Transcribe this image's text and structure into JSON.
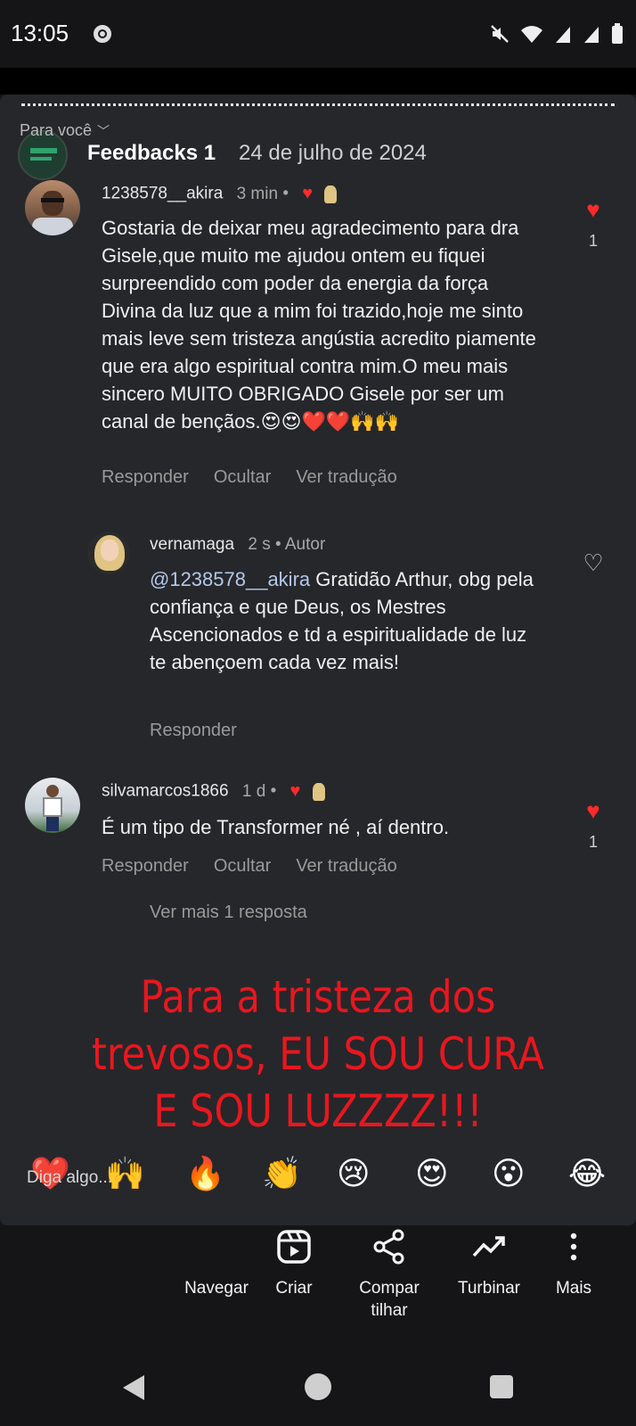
{
  "status_bar": {
    "time": "13:05",
    "icons": [
      "chrome-icon",
      "mute-icon",
      "wifi-icon",
      "signal-icon",
      "signal-icon",
      "battery-icon"
    ]
  },
  "header": {
    "feed_label": "Para você",
    "title": "Feedbacks 1",
    "date": "24 de julho de 2024"
  },
  "comments": [
    {
      "username": "1238578__akira",
      "time": "3 min",
      "body": "Gostaria de deixar meu agradecimento para dra Gisele,que muito me ajudou ontem eu fiquei surpreendido com poder da energia da força Divina da luz que a mim foi trazido,hoje me sinto mais leve sem tristeza angústia acredito piamente que era algo espiritual contra mim.O meu mais sincero MUITO OBRIGADO Gisele por ser um canal de bençãos.😍😍❤️❤️🙌🙌",
      "actions": [
        "Responder",
        "Ocultar",
        "Ver tradução"
      ],
      "likes": "1",
      "liked": true
    },
    {
      "username": "vernamaga",
      "time": "2 s",
      "badge": "Autor",
      "mention": "@1238578__akira",
      "body": " Gratidão Arthur, obg pela confiança e que Deus, os Mestres Ascencionados e td a espiritualidade de luz te abençoem cada vez mais!",
      "actions": [
        "Responder"
      ],
      "liked": false
    },
    {
      "username": "silvamarcos1866",
      "time": "1 d",
      "body": "É um tipo de Transformer né , aí dentro.",
      "actions": [
        "Responder",
        "Ocultar",
        "Ver tradução"
      ],
      "likes": "1",
      "liked": true,
      "more_replies": "Ver mais 1 resposta"
    }
  ],
  "overlay_text": [
    "Para a tristeza dos",
    "trevosos, EU SOU CURA",
    "E SOU LUZZZZ!!!"
  ],
  "reactions": [
    "❤️",
    "🙌",
    "🔥",
    "👏",
    "😢",
    "😍",
    "😮",
    "😂"
  ],
  "reply_placeholder": "Diga algo...",
  "bottom_nav": [
    {
      "label": "Navegar",
      "icon": "compass-icon"
    },
    {
      "label": "Criar",
      "icon": "reels-icon"
    },
    {
      "label": "Compar\ntilhar",
      "icon": "share-icon"
    },
    {
      "label": "Turbinar",
      "icon": "trending-icon"
    },
    {
      "label": "Mais",
      "icon": "more-vertical-icon"
    }
  ],
  "colors": {
    "background": "#151518",
    "card": "#26272b",
    "heart": "#ff2a2a",
    "overlay_text": "#e8171f",
    "mention": "#b5c8ea"
  }
}
